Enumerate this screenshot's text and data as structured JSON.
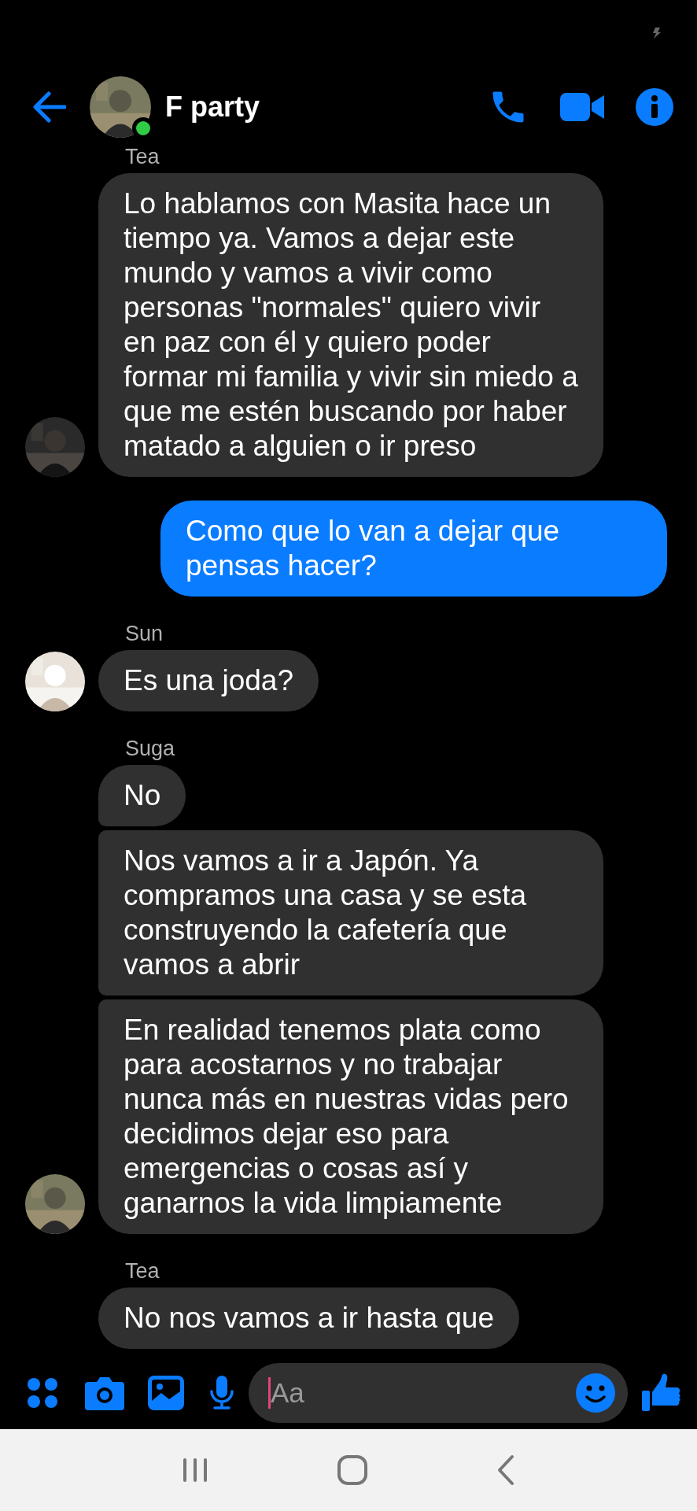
{
  "header": {
    "title": "F party",
    "online": true
  },
  "messages": [
    {
      "kind": "received",
      "sender": "Tea",
      "avatar_shown": true,
      "texts": [
        "Lo hablamos con Masita hace un tiempo ya. Vamos a dejar este mundo y vamos a vivir como personas \"normales\" quiero vivir en paz con él y quiero poder formar mi familia y vivir sin miedo a que me estén buscando por haber matado a alguien o ir preso"
      ]
    },
    {
      "kind": "sent",
      "texts": [
        "Como que lo van a dejar que pensas hacer?"
      ]
    },
    {
      "kind": "received",
      "sender": "Sun",
      "avatar_shown": true,
      "texts": [
        "Es una joda?"
      ]
    },
    {
      "kind": "received",
      "sender": "Suga",
      "avatar_shown": true,
      "texts": [
        "No",
        "Nos vamos a ir a Japón. Ya compramos una casa y se esta construyendo la cafetería que vamos a abrir",
        "En realidad tenemos plata como para acostarnos y no trabajar nunca más en nuestras vidas pero decidimos dejar eso para emergencias o cosas así y ganarnos la vida limpiamente"
      ]
    },
    {
      "kind": "received",
      "sender": "Tea",
      "avatar_shown": false,
      "texts": [
        "No nos vamos a ir hasta que"
      ]
    }
  ],
  "composer": {
    "placeholder": "Aa"
  }
}
